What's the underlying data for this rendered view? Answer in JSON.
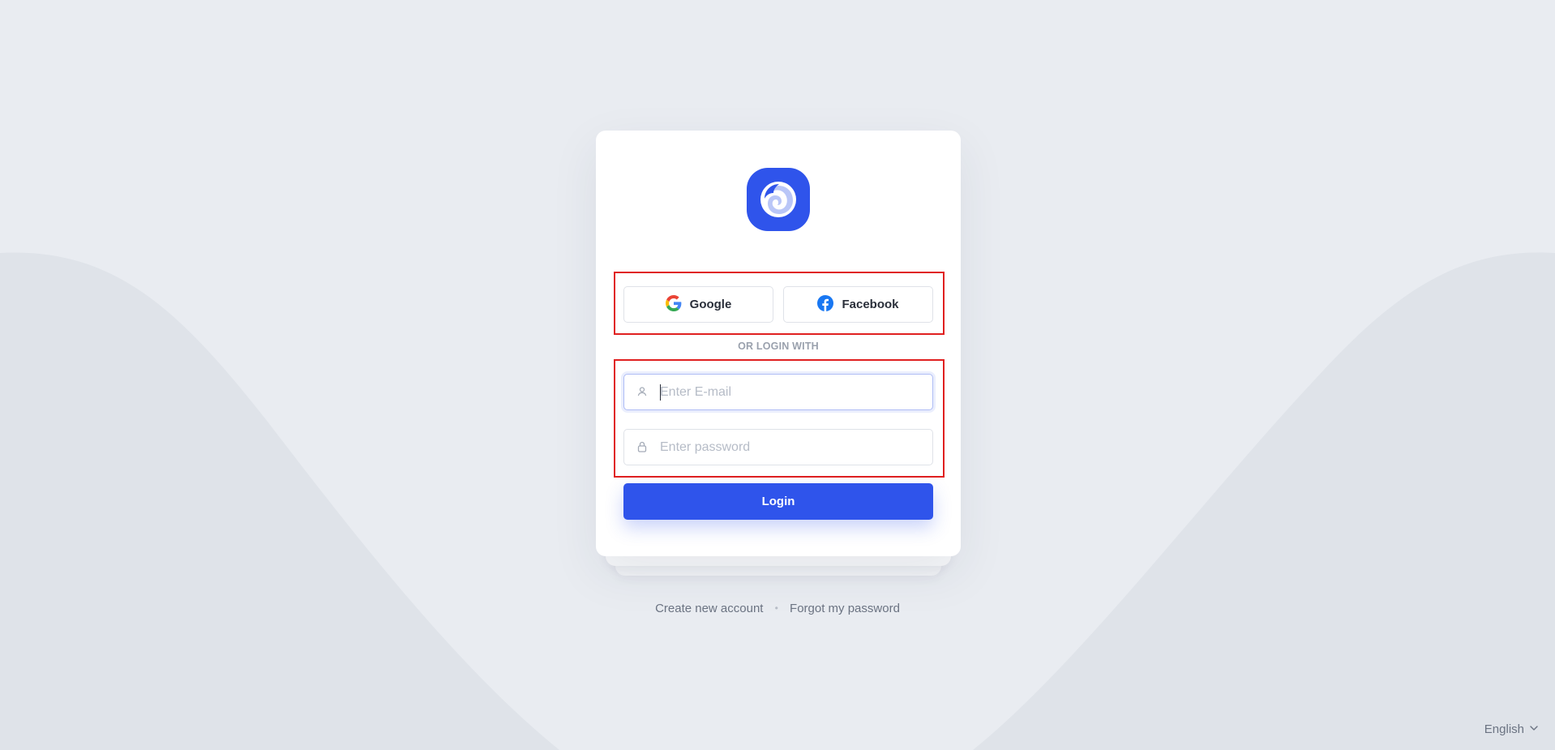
{
  "login": {
    "social": {
      "google_label": "Google",
      "facebook_label": "Facebook"
    },
    "divider_text": "OR LOGIN WITH",
    "email": {
      "placeholder": "Enter E-mail",
      "value": ""
    },
    "password": {
      "placeholder": "Enter password",
      "value": ""
    },
    "login_label": "Login"
  },
  "footer_links": {
    "create_account": "Create new account",
    "separator": "•",
    "forgot_password": "Forgot my password"
  },
  "language": {
    "selected": "English"
  },
  "icons": {
    "logo": "swirl-logo-icon",
    "google": "google-icon",
    "facebook": "facebook-icon",
    "email": "user-icon",
    "password": "lock-icon",
    "language": "chevron-down-icon"
  },
  "colors": {
    "primary": "#2f54eb",
    "background": "#e9ecf1",
    "highlight": "#e02020"
  }
}
